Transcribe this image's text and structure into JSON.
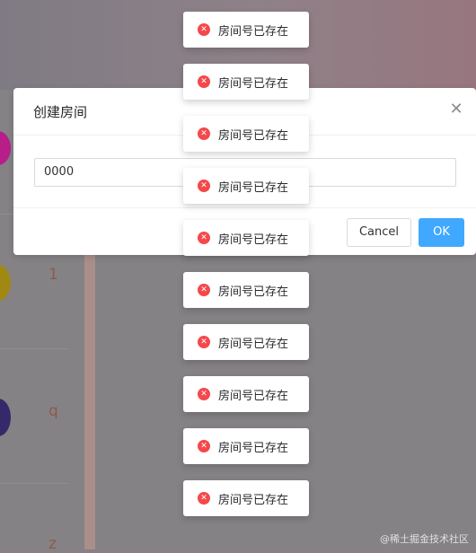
{
  "background": {
    "list_letters": [
      "1",
      "q",
      "z"
    ]
  },
  "dialog": {
    "title": "创建房间",
    "close_glyph": "✕",
    "input_value": "0000",
    "cancel_label": "Cancel",
    "ok_label": "OK"
  },
  "toasts": [
    {
      "icon": "error-icon",
      "text": "房间号已存在"
    },
    {
      "icon": "error-icon",
      "text": "房间号已存在"
    },
    {
      "icon": "error-icon",
      "text": "房间号已存在"
    },
    {
      "icon": "error-icon",
      "text": "房间号已存在"
    },
    {
      "icon": "error-icon",
      "text": "房间号已存在"
    },
    {
      "icon": "error-icon",
      "text": "房间号已存在"
    },
    {
      "icon": "error-icon",
      "text": "房间号已存在"
    },
    {
      "icon": "error-icon",
      "text": "房间号已存在"
    },
    {
      "icon": "error-icon",
      "text": "房间号已存在"
    },
    {
      "icon": "error-icon",
      "text": "房间号已存在"
    }
  ],
  "watermark": "@稀土掘金技术社区",
  "colors": {
    "primary": "#40a9ff",
    "error": "#f5484b"
  }
}
